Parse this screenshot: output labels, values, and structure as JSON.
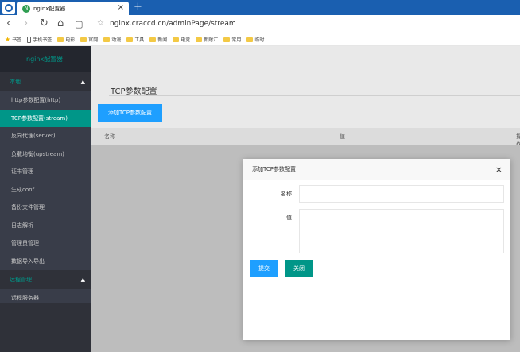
{
  "browser": {
    "tab_title": "nginx配置器",
    "tab_close": "×",
    "new_tab": "+",
    "url": "nginx.craccd.cn/adminPage/stream",
    "nav_back": "‹",
    "nav_forward": "›",
    "nav_reload": "↻",
    "nav_home": "⌂",
    "nav_reader": "▢",
    "bookmark_star": "☆",
    "bookmarks": [
      {
        "label": "书签",
        "icon": "star-icon"
      },
      {
        "label": "手机书签",
        "icon": "mobile-icon"
      },
      {
        "label": "电影",
        "icon": "folder-icon"
      },
      {
        "label": "官网",
        "icon": "folder-icon"
      },
      {
        "label": "动漫",
        "icon": "folder-icon"
      },
      {
        "label": "工具",
        "icon": "folder-icon"
      },
      {
        "label": "新闻",
        "icon": "folder-icon"
      },
      {
        "label": "电竞",
        "icon": "folder-icon"
      },
      {
        "label": "新财汇",
        "icon": "folder-icon"
      },
      {
        "label": "常用",
        "icon": "folder-icon"
      },
      {
        "label": "临时",
        "icon": "folder-icon"
      }
    ]
  },
  "sidebar": {
    "logo": "nginx配置器",
    "groups": [
      {
        "title": "本地",
        "caret": "▲",
        "items": [
          {
            "label": "http参数配置(http)"
          },
          {
            "label": "TCP参数配置(stream)"
          },
          {
            "label": "反向代理(server)"
          },
          {
            "label": "负载均衡(upstream)"
          },
          {
            "label": "证书管理"
          },
          {
            "label": "生成conf"
          },
          {
            "label": "备份文件管理"
          },
          {
            "label": "日志解析"
          },
          {
            "label": "管理员管理"
          },
          {
            "label": "数据导入导出"
          }
        ]
      },
      {
        "title": "远程管理",
        "caret": "▲",
        "items": [
          {
            "label": "远程服务器"
          }
        ]
      }
    ]
  },
  "main": {
    "title": "TCP参数配置",
    "add_button": "添加TCP参数配置",
    "columns": [
      "名称",
      "值",
      "操作"
    ]
  },
  "dialog": {
    "title": "添加TCP参数配置",
    "close": "×",
    "name_label": "名称",
    "value_label": "值",
    "name_value": "",
    "value_value": "",
    "submit": "提交",
    "cancel": "关闭"
  },
  "colors": {
    "accent": "#009688",
    "primary": "#1e9fff",
    "sidebar": "#393d49",
    "browser": "#1a5fb0"
  }
}
